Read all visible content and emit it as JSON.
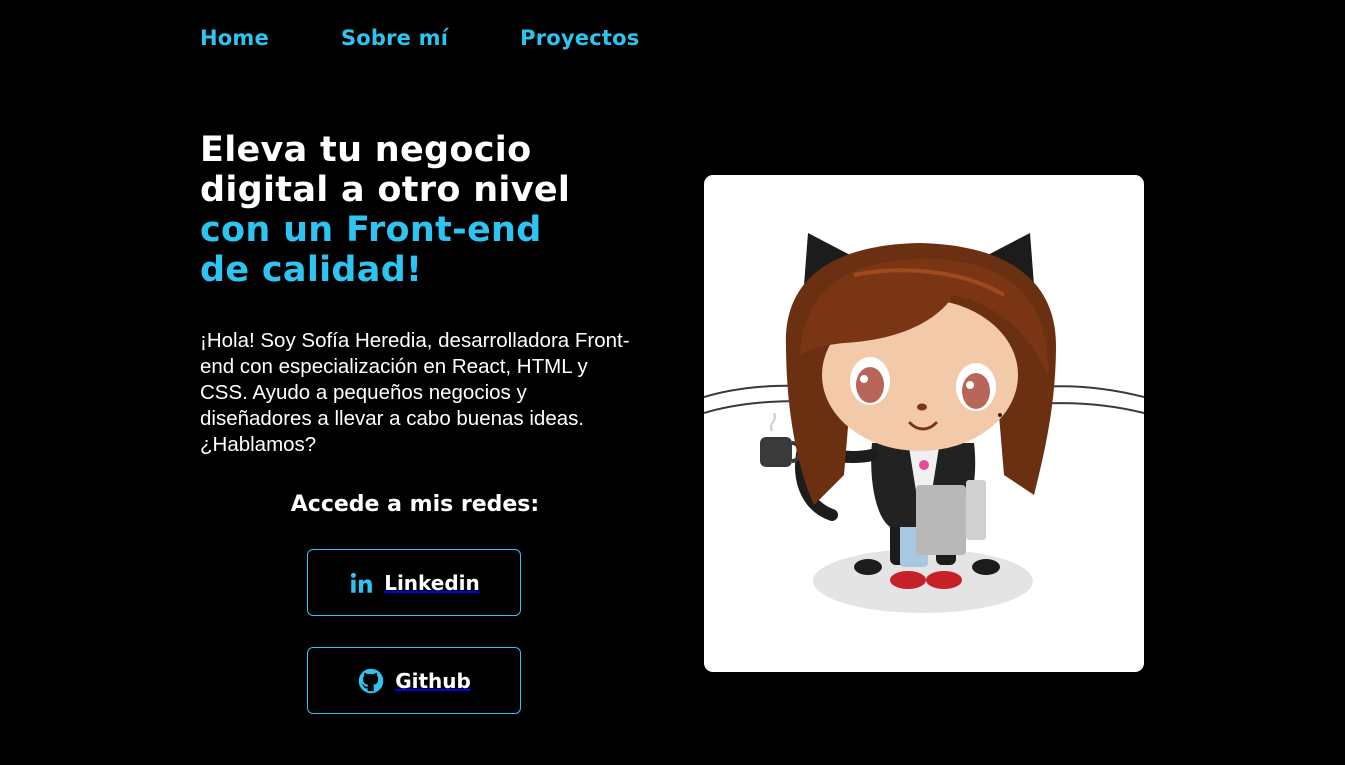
{
  "nav": {
    "items": [
      {
        "label": "Home"
      },
      {
        "label": "Sobre mí"
      },
      {
        "label": "Proyectos"
      }
    ]
  },
  "hero": {
    "headline_line1": "Eleva tu negocio",
    "headline_line2": "digital a otro nivel",
    "headline_line3": "con un Front-end",
    "headline_line4": "de calidad!",
    "intro": "¡Hola! Soy Sofía Heredia, desarrolladora Front-end con especialización en React, HTML y CSS. Ayudo a pequeños negocios y diseñadores a llevar a cabo buenas ideas. ¿Hablamos?"
  },
  "social": {
    "title": "Accede a mis redes:",
    "linkedin_label": "Linkedin",
    "linkedin_icon": "linkedin-icon",
    "github_label": "Github",
    "github_icon": "github-icon"
  },
  "image": {
    "icon": "octocat-illustration"
  },
  "colors": {
    "background": "#000000",
    "accent": "#2ec4f1",
    "text": "#ffffff",
    "card": "#ffffff"
  }
}
